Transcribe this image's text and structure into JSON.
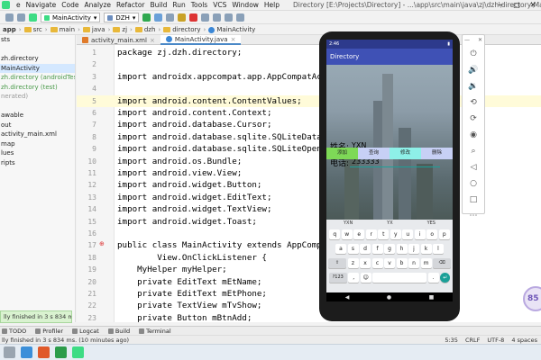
{
  "menubar": {
    "items": [
      "e",
      "Navigate",
      "Code",
      "Analyze",
      "Refactor",
      "Build",
      "Run",
      "Tools",
      "VCS",
      "Window",
      "Help"
    ],
    "title": "Directory [E:\\Projects\\Directory] - ...\\app\\src\\main\\java\\zj\\dzh\\directory\\MainActivity.java [app] - Android Studio"
  },
  "toolbar": {
    "run_config": "MainActivity",
    "device": "DZH"
  },
  "breadcrumb": [
    "app",
    "src",
    "main",
    "java",
    "zj",
    "dzh",
    "directory",
    "MainActivity"
  ],
  "project_tree": [
    {
      "label": "sts",
      "style": "normal"
    },
    {
      "label": "",
      "style": "normal"
    },
    {
      "label": "zh.directory",
      "style": "normal"
    },
    {
      "label": "MainActivity",
      "style": "selected"
    },
    {
      "label": "zh.directory (androidTest)",
      "style": "green"
    },
    {
      "label": "zh.directory (test)",
      "style": "green"
    },
    {
      "label": "nerated)",
      "style": "gray"
    },
    {
      "label": "",
      "style": "normal"
    },
    {
      "label": "awable",
      "style": "normal"
    },
    {
      "label": "out",
      "style": "normal"
    },
    {
      "label": "activity_main.xml",
      "style": "normal"
    },
    {
      "label": "map",
      "style": "normal"
    },
    {
      "label": "lues",
      "style": "normal"
    },
    {
      "label": "ripts",
      "style": "normal"
    }
  ],
  "tabs": [
    {
      "label": "activity_main.xml",
      "icon": "xml-icon",
      "active": false
    },
    {
      "label": "MainActivity.java",
      "icon": "class-icon",
      "active": true
    }
  ],
  "code_lines": [
    {
      "n": "1",
      "t": "package zj.dzh.directory;"
    },
    {
      "n": "2",
      "t": ""
    },
    {
      "n": "3",
      "t": "import androidx.appcompat.app.AppCompatActivity;"
    },
    {
      "n": "4",
      "t": ""
    },
    {
      "n": "5",
      "t": "import android.content.ContentValues;"
    },
    {
      "n": "6",
      "t": "import android.content.Context;"
    },
    {
      "n": "7",
      "t": "import android.database.Cursor;"
    },
    {
      "n": "8",
      "t": "import android.database.sqlite.SQLiteDatabase;"
    },
    {
      "n": "9",
      "t": "import android.database.sqlite.SQLiteOpenHelper;"
    },
    {
      "n": "10",
      "t": "import android.os.Bundle;"
    },
    {
      "n": "11",
      "t": "import android.view.View;"
    },
    {
      "n": "12",
      "t": "import android.widget.Button;"
    },
    {
      "n": "13",
      "t": "import android.widget.EditText;"
    },
    {
      "n": "14",
      "t": "import android.widget.TextView;"
    },
    {
      "n": "15",
      "t": "import android.widget.Toast;"
    },
    {
      "n": "16",
      "t": ""
    },
    {
      "n": "17",
      "t": "public class MainActivity extends AppCompatActivity implements"
    },
    {
      "n": "18",
      "t": "        View.OnClickListener {"
    },
    {
      "n": "19",
      "t": "    MyHelper myHelper;"
    },
    {
      "n": "20",
      "t": "    private EditText mEtName;"
    },
    {
      "n": "21",
      "t": "    private EditText mEtPhone;"
    },
    {
      "n": "22",
      "t": "    private TextView mTvShow;"
    },
    {
      "n": "23",
      "t": "    private Button mBtnAdd;"
    },
    {
      "n": "24",
      "t": "    private Button mBtnQuery;"
    }
  ],
  "balloon": "lly finished in 3 s 834 ms.",
  "bottom_tabs": [
    "TODO",
    "Profiler",
    "Logcat",
    "Build",
    "Terminal"
  ],
  "status": {
    "message": "lly finished in 3 s 834 ms. (10 minutes ago)",
    "position": "5:35",
    "line_sep": "CRLF",
    "encoding": "UTF-8",
    "indent": "4 spaces"
  },
  "emulator": {
    "status_time": "2:46",
    "app_title": "Directory",
    "name_label": "姓名:",
    "name_value": "YXN",
    "phone_label": "电话:",
    "phone_value": "233333",
    "buttons": [
      {
        "label": "添加",
        "color": "#7ed957"
      },
      {
        "label": "查询",
        "color": "#c7d0f5"
      },
      {
        "label": "修改",
        "color": "#8ef0e8"
      },
      {
        "label": "删除",
        "color": "#c7d0f5"
      }
    ],
    "suggestions": [
      "YXN",
      "YX",
      "YES"
    ],
    "rows": [
      [
        "q",
        "w",
        "e",
        "r",
        "t",
        "y",
        "u",
        "i",
        "o",
        "p"
      ],
      [
        "a",
        "s",
        "d",
        "f",
        "g",
        "h",
        "j",
        "k",
        "l"
      ],
      [
        "⇧",
        "z",
        "x",
        "c",
        "v",
        "b",
        "n",
        "m",
        "⌫"
      ],
      [
        "?123",
        ",",
        "☺",
        "",
        "",
        ".",
        "↵"
      ]
    ]
  },
  "corner_logo": "85"
}
